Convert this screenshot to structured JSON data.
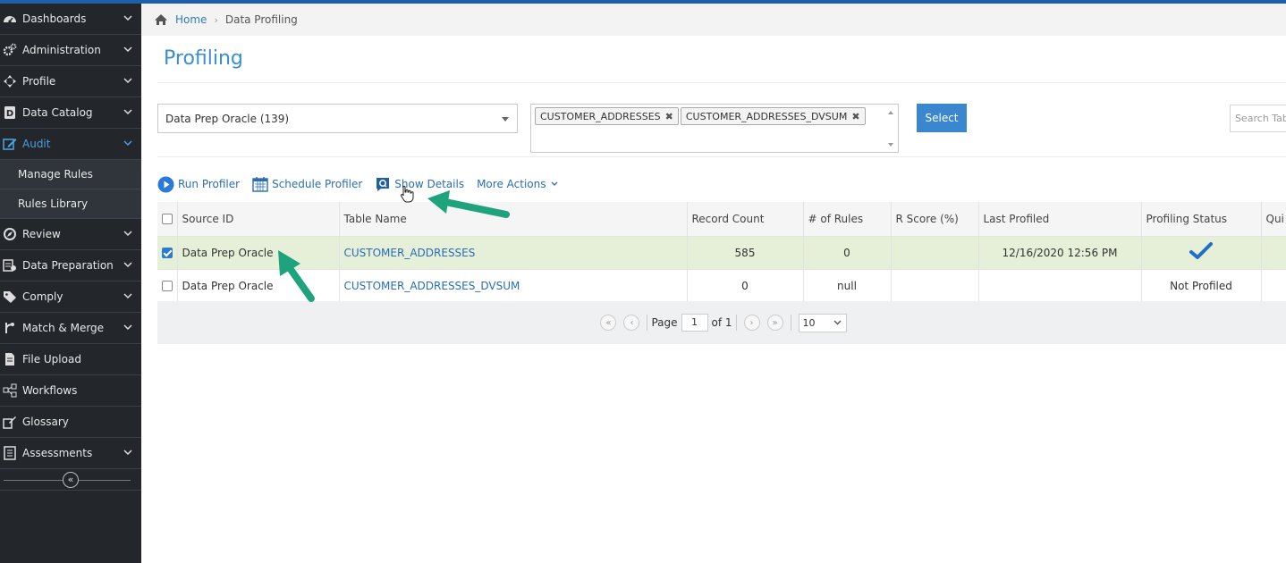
{
  "sidebar": {
    "items": [
      {
        "label": "Dashboards",
        "icon": "dashboard-icon",
        "chevron": true
      },
      {
        "label": "Administration",
        "icon": "gears-icon",
        "chevron": true
      },
      {
        "label": "Profile",
        "icon": "profile-icon",
        "chevron": true
      },
      {
        "label": "Data Catalog",
        "icon": "catalog-icon",
        "chevron": true
      },
      {
        "label": "Audit",
        "icon": "edit-icon",
        "chevron": true,
        "active": true
      },
      {
        "label": "Review",
        "icon": "review-icon",
        "chevron": true
      },
      {
        "label": "Data Preparation",
        "icon": "data-prep-icon",
        "chevron": true
      },
      {
        "label": "Comply",
        "icon": "tag-icon",
        "chevron": true
      },
      {
        "label": "Match & Merge",
        "icon": "merge-icon",
        "chevron": true
      },
      {
        "label": "File Upload",
        "icon": "file-icon",
        "chevron": false
      },
      {
        "label": "Workflows",
        "icon": "workflow-icon",
        "chevron": false
      },
      {
        "label": "Glossary",
        "icon": "glossary-icon",
        "chevron": false
      },
      {
        "label": "Assessments",
        "icon": "assessment-icon",
        "chevron": true
      }
    ],
    "audit_sub": [
      "Manage Rules",
      "Rules Library"
    ],
    "collapse_symbol": "«"
  },
  "breadcrumb": {
    "home": "Home",
    "current": "Data Profiling"
  },
  "page": {
    "title": "Profiling"
  },
  "filters": {
    "source": "Data Prep Oracle (139)",
    "tags": [
      "CUSTOMER_ADDRESSES",
      "CUSTOMER_ADDRESSES_DVSUM"
    ],
    "select_label": "Select",
    "search_placeholder": "Search Tab"
  },
  "toolbar": {
    "run_profiler": "Run Profiler",
    "schedule_profiler": "Schedule Profiler",
    "show_details": "Show Details",
    "more_actions": "More Actions"
  },
  "table": {
    "columns": [
      "Source ID",
      "Table Name",
      "Record Count",
      "# of Rules",
      "R Score (%)",
      "Last Profiled",
      "Profiling Status",
      "Qui"
    ],
    "rows": [
      {
        "selected": true,
        "source": "Data Prep Oracle",
        "table": "CUSTOMER_ADDRESSES",
        "records": "585",
        "rules": "0",
        "rscore": "",
        "last": "12/16/2020 12:56 PM",
        "status": "",
        "status_icon": "checkmark-icon"
      },
      {
        "selected": false,
        "source": "Data Prep Oracle",
        "table": "CUSTOMER_ADDRESSES_DVSUM",
        "records": "0",
        "rules": "null",
        "rscore": "",
        "last": "",
        "status": "Not Profiled",
        "status_icon": ""
      }
    ]
  },
  "pager": {
    "page_label": "Page",
    "page": "1",
    "of_label": "of 1",
    "page_size": "10"
  },
  "colors": {
    "accent": "#3a87d0",
    "sidebar": "#23272c",
    "selected_row": "#e6efd8",
    "annotation": "#1fa37c"
  }
}
